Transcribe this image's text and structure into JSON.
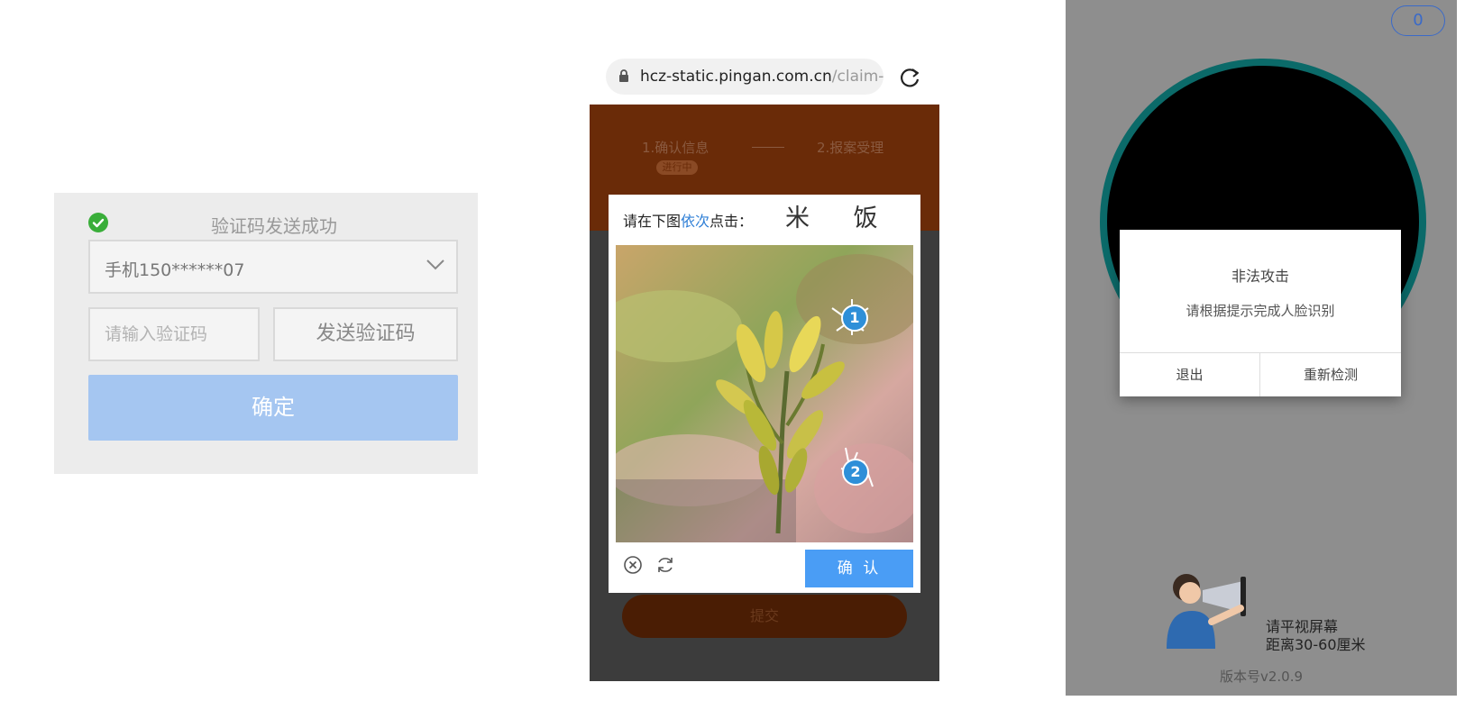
{
  "sms_panel": {
    "status_text": "验证码发送成功",
    "status_icon": "check-circle-icon",
    "phone_select_value": "手机150******07",
    "code_input_placeholder": "请输入验证码",
    "send_code_label": "发送验证码",
    "confirm_label": "确定"
  },
  "browser_panel": {
    "url_host": "hcz-static.pingan.com.cn",
    "url_rest": "/claim-ce",
    "steps": [
      {
        "label": "1.确认信息"
      },
      {
        "label": "2.报案受理"
      }
    ],
    "step_badge": "进行中",
    "submit_label": "提交",
    "captcha": {
      "prompt_before": "请在下图",
      "prompt_highlight": "依次",
      "prompt_after": "点击：",
      "target_chars": "米 饭",
      "markers": [
        "1",
        "2"
      ],
      "confirm_label": "确 认"
    }
  },
  "face_panel": {
    "counter_badge": "0",
    "dialog_title": "非法攻击",
    "dialog_message": "请根据提示完成人脸识别",
    "exit_label": "退出",
    "retry_label": "重新检测",
    "hint_line1": "请平视屏幕",
    "hint_line2": "距离30-60厘米",
    "version": "版本号v2.0.9"
  },
  "colors": {
    "success_green": "#3aae3a",
    "confirm_blue_disabled": "#a5c6f1",
    "captcha_blue": "#4a9df5",
    "ring_teal": "#0b6a69",
    "badge_blue": "#3a6ac9"
  }
}
